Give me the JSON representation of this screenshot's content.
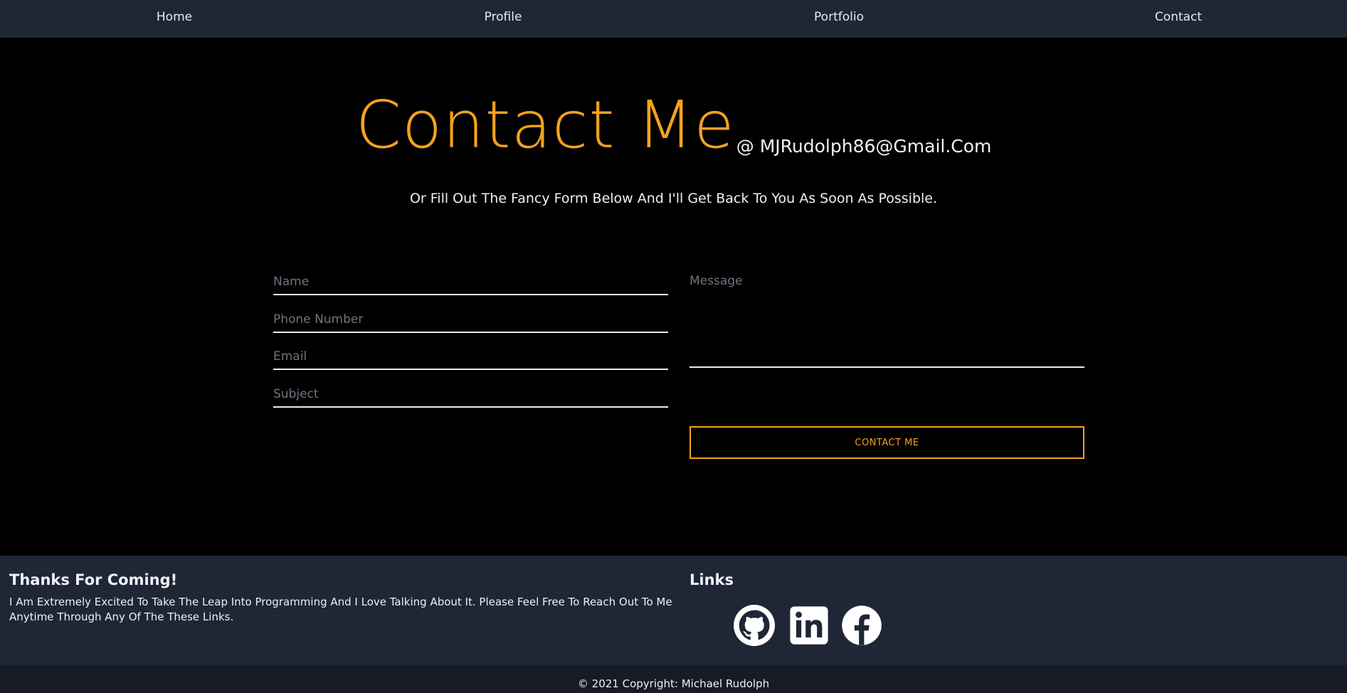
{
  "nav": {
    "items": [
      {
        "label": "Home"
      },
      {
        "label": "Profile"
      },
      {
        "label": "Portfolio"
      },
      {
        "label": "Contact"
      }
    ]
  },
  "hero": {
    "title": "Contact Me",
    "email": "@ MJRudolph86@Gmail.Com",
    "subtitle": "Or Fill Out The Fancy Form Below And I'll Get Back To You As Soon As Possible."
  },
  "form": {
    "name_placeholder": "Name",
    "phone_placeholder": "Phone Number",
    "email_placeholder": "Email",
    "subject_placeholder": "Subject",
    "message_placeholder": "Message",
    "submit_label": "CONTACT ME"
  },
  "footer": {
    "title": "Thanks For Coming!",
    "text": "I Am Extremely Excited To Take The Leap Into Programming And I Love Talking About It. Please Feel Free To Reach Out To Me Anytime Through Any Of The These Links.",
    "links_title": "Links",
    "social_icons": [
      "github-icon",
      "linkedin-icon",
      "facebook-icon"
    ],
    "copyright": "© 2021 Copyright: Michael Rudolph"
  },
  "colors": {
    "accent": "#f4a21d",
    "navbar_bg": "#1f2635",
    "footer_bg": "#1f2635",
    "copyright_bg": "#161b25",
    "page_bg": "#000000"
  }
}
